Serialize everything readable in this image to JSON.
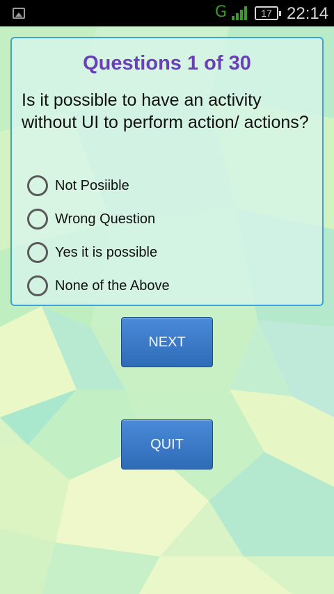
{
  "status_bar": {
    "network_type": "G",
    "battery_level": "17",
    "time": "22:14"
  },
  "quiz": {
    "counter": "Questions 1 of 30",
    "question": "Is it possible to have an activity without UI to perform action/ actions?",
    "options": [
      {
        "label": "Not Posiible",
        "selected": false
      },
      {
        "label": "Wrong Question",
        "selected": false
      },
      {
        "label": "Yes it is possible",
        "selected": false
      },
      {
        "label": "None of the Above",
        "selected": false
      }
    ]
  },
  "buttons": {
    "next_label": "NEXT",
    "quit_label": "QUIT"
  },
  "colors": {
    "counter": "#6a3fb8",
    "card_border": "#3fa0e0",
    "button": "#3a79c7",
    "background_light": "#eef9c9",
    "background_mid": "#c6efc6",
    "background_teal": "#a8ead3"
  },
  "icons": {
    "status_left": "image-notification-icon",
    "signal": "signal-strength-icon",
    "battery": "battery-icon"
  }
}
